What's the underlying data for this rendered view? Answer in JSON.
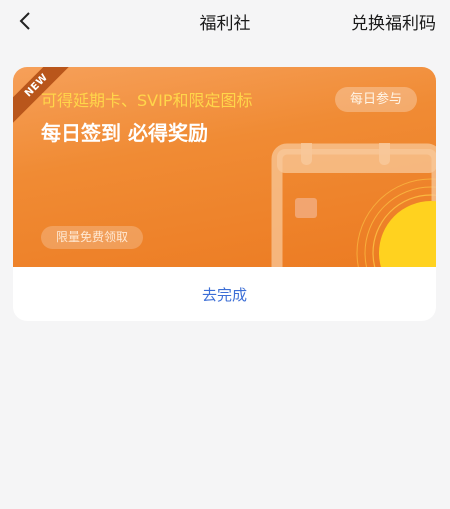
{
  "header": {
    "title": "福利社",
    "redeem_label": "兑换福利码"
  },
  "card": {
    "ribbon": "NEW",
    "subtitle": "可得延期卡、SVIP和限定图标",
    "title": "每日签到 必得奖励",
    "daily_badge": "每日参与",
    "free_badge": "限量免费领取",
    "action_label": "去完成"
  },
  "colors": {
    "banner_gradient": [
      "#f6a05a",
      "#ec7b22"
    ],
    "subtitle_yellow": "#ffd64a",
    "action_blue": "#3d6fd6",
    "sun_yellow": "#ffd21f"
  },
  "icons": {
    "back": "chevron-left-icon",
    "illustration": "calendar-sun-illustration"
  }
}
